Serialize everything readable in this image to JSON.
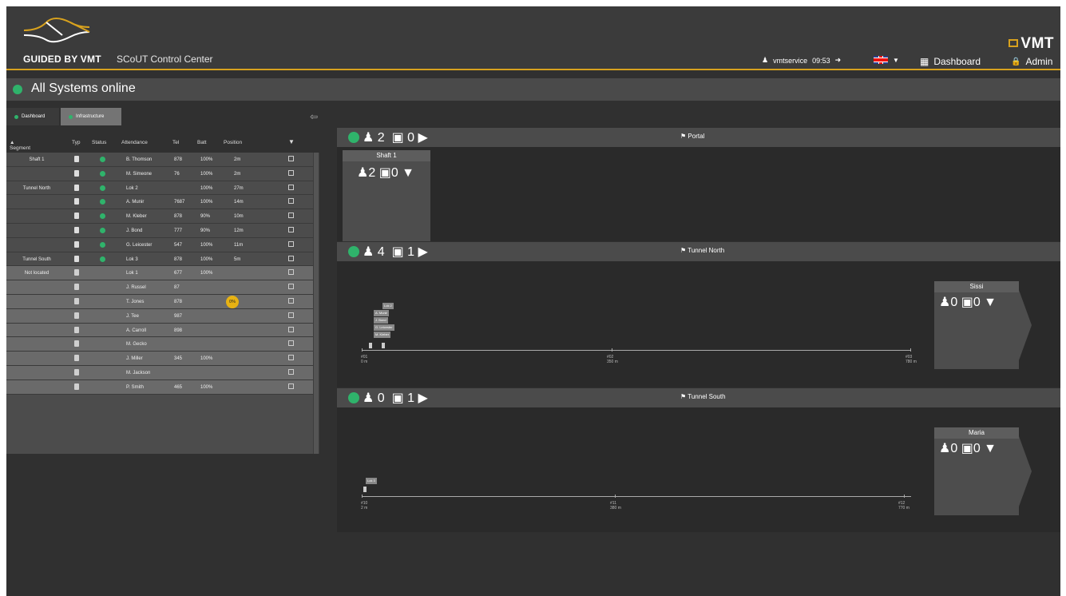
{
  "header": {
    "logo_text": "GUIDED BY VMT",
    "app_title": "SCoUT Control Center",
    "brand": "VMT",
    "user": "vmtservice",
    "time": "09:53",
    "dashboard": "Dashboard",
    "admin": "Admin",
    "colors": {
      "accent": "#d8a21e",
      "ok": "#2fb36b"
    }
  },
  "status": {
    "text": "All Systems online"
  },
  "tabs": [
    "Dashboard",
    "Infrastructure"
  ],
  "table": {
    "headers": [
      "Segment",
      "Typ",
      "Status",
      "Attendance",
      "Tel",
      "Batt",
      "Position"
    ],
    "rows": [
      {
        "segment": "Shaft 1",
        "attendance": "B. Thomson",
        "tel": "878",
        "batt": "100%",
        "pos": "2m"
      },
      {
        "segment": "",
        "attendance": "M. Simeone",
        "tel": "76",
        "batt": "100%",
        "pos": "2m"
      },
      {
        "segment": "Tunnel North",
        "attendance": "Lok 2",
        "tel": "",
        "batt": "100%",
        "pos": "27m"
      },
      {
        "segment": "",
        "attendance": "A. Munir",
        "tel": "7687",
        "batt": "100%",
        "pos": "14m"
      },
      {
        "segment": "",
        "attendance": "M. Kleber",
        "tel": "878",
        "batt": "90%",
        "pos": "10m"
      },
      {
        "segment": "",
        "attendance": "J. Bond",
        "tel": "777",
        "batt": "90%",
        "pos": "12m"
      },
      {
        "segment": "",
        "attendance": "G. Leicester",
        "tel": "547",
        "batt": "100%",
        "pos": "11m"
      },
      {
        "segment": "Tunnel South",
        "attendance": "Lok 3",
        "tel": "878",
        "batt": "100%",
        "pos": "5m"
      },
      {
        "segment": "Not located",
        "attendance": "Lok 1",
        "tel": "677",
        "batt": "100%",
        "pos": ""
      },
      {
        "segment": "",
        "attendance": "J. Russel",
        "tel": "87",
        "batt": "",
        "pos": ""
      },
      {
        "segment": "",
        "attendance": "T. Jones",
        "tel": "878",
        "batt": "",
        "pos": "",
        "badge": "0%"
      },
      {
        "segment": "",
        "attendance": "J. Tee",
        "tel": "987",
        "batt": "",
        "pos": ""
      },
      {
        "segment": "",
        "attendance": "A. Carroll",
        "tel": "898",
        "batt": "",
        "pos": ""
      },
      {
        "segment": "",
        "attendance": "M. Gecko",
        "tel": "",
        "batt": "",
        "pos": ""
      },
      {
        "segment": "",
        "attendance": "J. Miller",
        "tel": "345",
        "batt": "100%",
        "pos": ""
      },
      {
        "segment": "",
        "attendance": "M. Jackson",
        "tel": "",
        "batt": "",
        "pos": ""
      },
      {
        "segment": "",
        "attendance": "P. Smith",
        "tel": "465",
        "batt": "100%",
        "pos": ""
      }
    ]
  },
  "zones": {
    "portal": {
      "title": "Portal",
      "persons": "2",
      "vehicles": "0",
      "sub": {
        "title": "Shaft 1",
        "persons": "2",
        "vehicles": "0"
      }
    },
    "north": {
      "title": "Tunnel North",
      "persons": "4",
      "vehicles": "1",
      "side": {
        "title": "Sissi",
        "persons": "0",
        "vehicles": "0"
      },
      "tags": [
        "Lok 2",
        "A. Munir",
        "J. Bond",
        "G. Leicester",
        "M. Kleber"
      ],
      "markers": [
        {
          "id": "#01",
          "dist": "0 m"
        },
        {
          "id": "#02",
          "dist": "350 m"
        },
        {
          "id": "#03",
          "dist": "780 m"
        }
      ]
    },
    "south": {
      "title": "Tunnel South",
      "persons": "0",
      "vehicles": "1",
      "side": {
        "title": "Maria",
        "persons": "0",
        "vehicles": "0"
      },
      "tags": [
        "Lok 3"
      ],
      "markers": [
        {
          "id": "#10",
          "dist": "2 m"
        },
        {
          "id": "#11",
          "dist": "380 m"
        },
        {
          "id": "#12",
          "dist": "770 m"
        }
      ]
    }
  }
}
